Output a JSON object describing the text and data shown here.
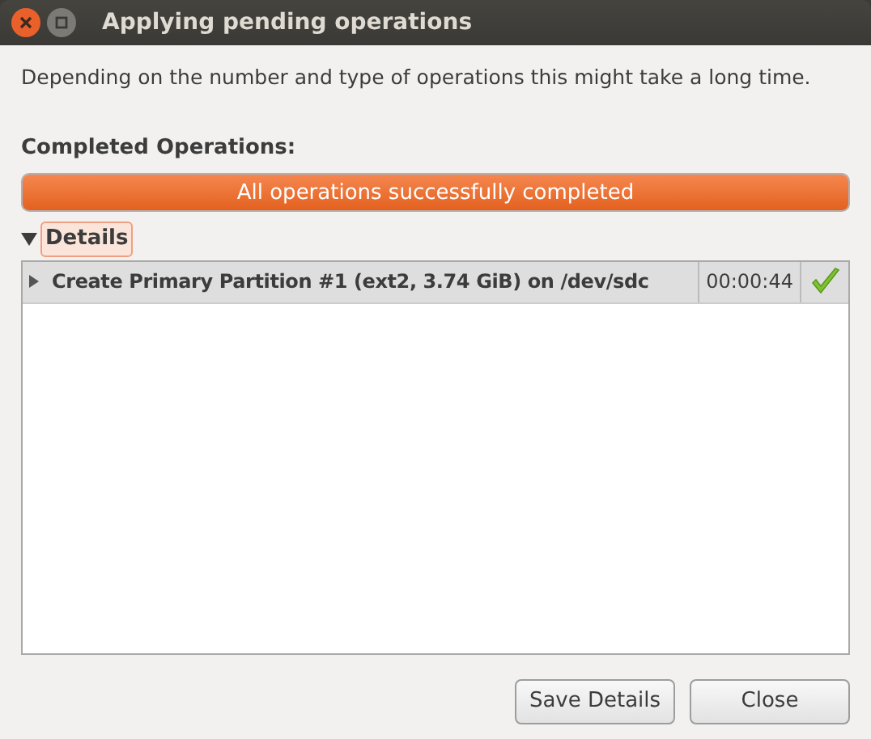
{
  "window": {
    "title": "Applying pending operations"
  },
  "message": "Depending on the number and type of operations this might take a long time.",
  "progress": {
    "label": "Completed Operations:",
    "level": 1,
    "text": "All operations successfully completed"
  },
  "details": {
    "label": "Details",
    "expanded": true,
    "rows": [
      {
        "operation": "Create Primary Partition #1 (ext2, 3.74 GiB) on /dev/sdc",
        "time": "00:00:44",
        "expanded": false,
        "completed": true
      }
    ]
  },
  "buttons": [
    "Save Details",
    "Close"
  ]
}
